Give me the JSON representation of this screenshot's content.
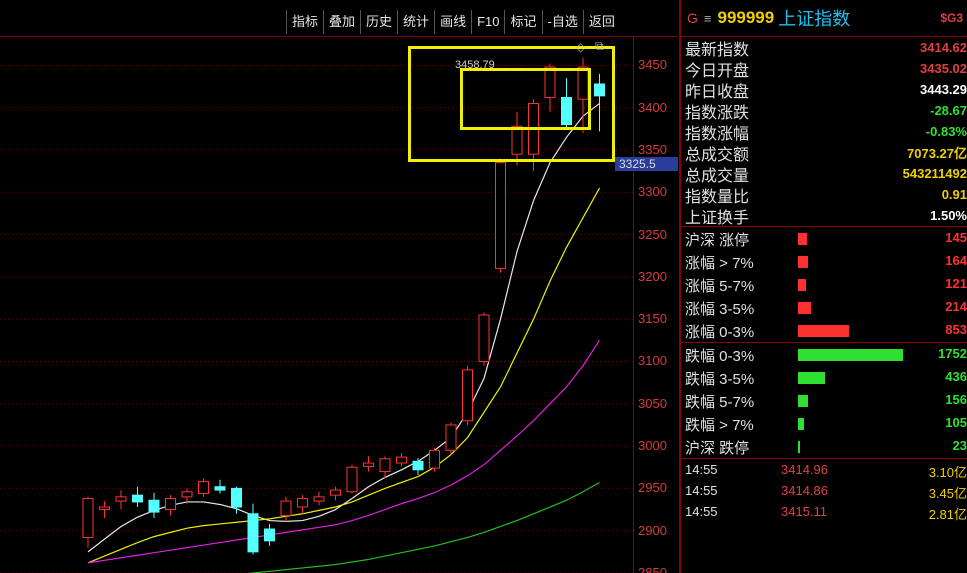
{
  "toolbar": {
    "buttons": [
      "指标",
      "叠加",
      "历史",
      "统计",
      "画线",
      "F10",
      "标记",
      "-自选",
      "返回"
    ]
  },
  "chart": {
    "y_ticks": [
      "3450",
      "3400",
      "3350",
      "3300",
      "3250",
      "3200",
      "3150",
      "3100",
      "3050",
      "3000",
      "2950",
      "2900",
      "2850"
    ],
    "current_price_label": "3325.5",
    "peak_label": "3458.79",
    "icons": [
      "diamond-icon",
      "settings-icon"
    ]
  },
  "chart_data": {
    "type": "candlestick",
    "ylim": [
      2850,
      3480
    ],
    "candles": [
      {
        "o": 2892,
        "c": 2938,
        "h": 2940,
        "l": 2880
      },
      {
        "o": 2925,
        "c": 2928,
        "h": 2935,
        "l": 2915
      },
      {
        "o": 2935,
        "c": 2940,
        "h": 2948,
        "l": 2925
      },
      {
        "o": 2942,
        "c": 2934,
        "h": 2952,
        "l": 2928
      },
      {
        "o": 2936,
        "c": 2922,
        "h": 2945,
        "l": 2915
      },
      {
        "o": 2925,
        "c": 2938,
        "h": 2942,
        "l": 2918
      },
      {
        "o": 2940,
        "c": 2946,
        "h": 2950,
        "l": 2932
      },
      {
        "o": 2944,
        "c": 2958,
        "h": 2962,
        "l": 2940
      },
      {
        "o": 2952,
        "c": 2948,
        "h": 2960,
        "l": 2944
      },
      {
        "o": 2950,
        "c": 2928,
        "h": 2952,
        "l": 2920
      },
      {
        "o": 2920,
        "c": 2875,
        "h": 2932,
        "l": 2872
      },
      {
        "o": 2902,
        "c": 2888,
        "h": 2908,
        "l": 2882
      },
      {
        "o": 2918,
        "c": 2935,
        "h": 2940,
        "l": 2910
      },
      {
        "o": 2928,
        "c": 2938,
        "h": 2942,
        "l": 2920
      },
      {
        "o": 2935,
        "c": 2940,
        "h": 2946,
        "l": 2930
      },
      {
        "o": 2942,
        "c": 2948,
        "h": 2952,
        "l": 2936
      },
      {
        "o": 2946,
        "c": 2975,
        "h": 2978,
        "l": 2944
      },
      {
        "o": 2976,
        "c": 2980,
        "h": 2988,
        "l": 2970
      },
      {
        "o": 2970,
        "c": 2985,
        "h": 2988,
        "l": 2962
      },
      {
        "o": 2980,
        "c": 2987,
        "h": 2992,
        "l": 2976
      },
      {
        "o": 2982,
        "c": 2972,
        "h": 2986,
        "l": 2966
      },
      {
        "o": 2974,
        "c": 2995,
        "h": 2998,
        "l": 2970
      },
      {
        "o": 2995,
        "c": 3025,
        "h": 3028,
        "l": 2990
      },
      {
        "o": 3030,
        "c": 3090,
        "h": 3095,
        "l": 3025
      },
      {
        "o": 3100,
        "c": 3155,
        "h": 3158,
        "l": 3095
      },
      {
        "o": 3210,
        "c": 3335,
        "h": 3340,
        "l": 3205
      },
      {
        "o": 3345,
        "c": 3378,
        "h": 3395,
        "l": 3332
      },
      {
        "o": 3345,
        "c": 3405,
        "h": 3410,
        "l": 3325
      },
      {
        "o": 3412,
        "c": 3448,
        "h": 3452,
        "l": 3395
      },
      {
        "o": 3412,
        "c": 3380,
        "h": 3435,
        "l": 3375
      },
      {
        "o": 3410,
        "c": 3448,
        "h": 3459,
        "l": 3370
      },
      {
        "o": 3428,
        "c": 3414,
        "h": 3440,
        "l": 3372
      }
    ],
    "ma": [
      {
        "color": "#e8e8e8",
        "values": [
          2875,
          2890,
          2905,
          2916,
          2924,
          2930,
          2934,
          2934,
          2931,
          2926,
          2918,
          2912,
          2911,
          2912,
          2917,
          2925,
          2938,
          2952,
          2963,
          2972,
          2982,
          2995,
          3010,
          3040,
          3080,
          3150,
          3230,
          3290,
          3335,
          3365,
          3390,
          3405
        ]
      },
      {
        "color": "#f0f000",
        "values": [
          2862,
          2870,
          2878,
          2886,
          2893,
          2898,
          2903,
          2906,
          2908,
          2910,
          2912,
          2914,
          2917,
          2920,
          2924,
          2928,
          2934,
          2942,
          2950,
          2957,
          2964,
          2975,
          2990,
          3010,
          3040,
          3070,
          3110,
          3150,
          3195,
          3235,
          3270,
          3305
        ]
      },
      {
        "color": "#e020e0",
        "values": [
          2862,
          2865,
          2868,
          2871,
          2874,
          2877,
          2880,
          2883,
          2886,
          2889,
          2892,
          2895,
          2898,
          2901,
          2904,
          2907,
          2912,
          2918,
          2925,
          2932,
          2938,
          2945,
          2954,
          2965,
          2978,
          2995,
          3012,
          3030,
          3050,
          3070,
          3095,
          3125
        ]
      },
      {
        "color": "#20c020",
        "values": [
          2830,
          2832,
          2834,
          2836,
          2838,
          2840,
          2842,
          2844,
          2846,
          2848,
          2850,
          2852,
          2854,
          2856,
          2858,
          2860,
          2863,
          2866,
          2870,
          2874,
          2878,
          2882,
          2887,
          2892,
          2898,
          2905,
          2912,
          2920,
          2928,
          2936,
          2946,
          2957
        ]
      }
    ]
  },
  "header": {
    "code": "999999",
    "name": "上证指数",
    "badge": "$G3",
    "prefix": "G",
    "menu_glyph": "≡"
  },
  "stats": [
    {
      "label": "最新指数",
      "value": "3414.62",
      "color": "#e04040"
    },
    {
      "label": "今日开盘",
      "value": "3435.02",
      "color": "#e04040"
    },
    {
      "label": "昨日收盘",
      "value": "3443.29",
      "color": "#ffffff"
    },
    {
      "label": "指数涨跌",
      "value": "-28.67",
      "color": "#30e030"
    },
    {
      "label": "指数涨幅",
      "value": "-0.83%",
      "color": "#30e030"
    },
    {
      "label": "总成交额",
      "value": "7073.27亿",
      "color": "#f0d000"
    },
    {
      "label": "总成交量",
      "value": "543211492",
      "color": "#f0d000"
    },
    {
      "label": "指数量比",
      "value": "0.91",
      "color": "#f0d000"
    },
    {
      "label": "上证换手",
      "value": "1.50%",
      "color": "#ffffff"
    }
  ],
  "distribution": [
    {
      "label": "沪深 涨停",
      "count": "145",
      "color": "#ff3030",
      "frac": 0.048
    },
    {
      "label": "涨幅 > 7%",
      "count": "164",
      "color": "#ff3030",
      "frac": 0.054
    },
    {
      "label": "涨幅 5-7%",
      "count": "121",
      "color": "#ff3030",
      "frac": 0.04
    },
    {
      "label": "涨幅 3-5%",
      "count": "214",
      "color": "#ff3030",
      "frac": 0.07
    },
    {
      "label": "涨幅 0-3%",
      "count": "853",
      "color": "#ff3030",
      "frac": 0.27
    },
    {
      "label": "跌幅 0-3%",
      "count": "1752",
      "color": "#30e030",
      "frac": 0.55
    },
    {
      "label": "跌幅 3-5%",
      "count": "436",
      "color": "#30e030",
      "frac": 0.14
    },
    {
      "label": "跌幅 5-7%",
      "count": "156",
      "color": "#30e030",
      "frac": 0.05
    },
    {
      "label": "跌幅 > 7%",
      "count": "105",
      "color": "#30e030",
      "frac": 0.034
    },
    {
      "label": "沪深 跌停",
      "count": "23",
      "color": "#30e030",
      "frac": 0.007
    }
  ],
  "ticks": [
    {
      "time": "14:55",
      "price": "3414.96",
      "vol": "3.10亿"
    },
    {
      "time": "14:55",
      "price": "3414.86",
      "vol": "3.45亿"
    },
    {
      "time": "14:55",
      "price": "3415.11",
      "vol": "2.81亿"
    }
  ]
}
